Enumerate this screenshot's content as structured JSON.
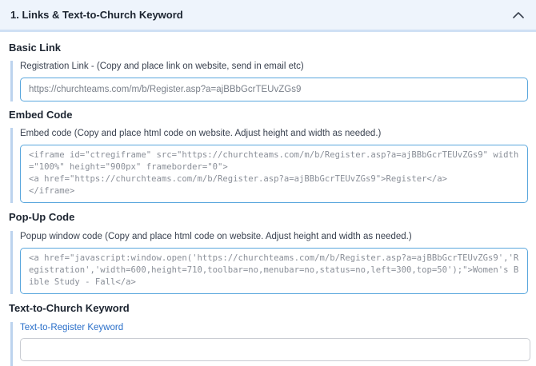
{
  "panel": {
    "title": "1. Links & Text-to-Church Keyword"
  },
  "basic_link": {
    "heading": "Basic Link",
    "label": "Registration Link - (Copy and place link on website, send in email etc)",
    "value": "https://churchteams.com/m/b/Register.asp?a=ajBBbGcrTEUvZGs9"
  },
  "embed_code": {
    "heading": "Embed Code",
    "label": "Embed code (Copy and place html code on website. Adjust height and width as needed.)",
    "value": "<iframe id=\"ctregiframe\" src=\"https://churchteams.com/m/b/Register.asp?a=ajBBbGcrTEUvZGs9\" width=\"100%\" height=\"900px\" frameborder=\"0\">\n<a href=\"https://churchteams.com/m/b/Register.asp?a=ajBBbGcrTEUvZGs9\">Register</a>\n</iframe>"
  },
  "popup_code": {
    "heading": "Pop-Up Code",
    "label": "Popup window code (Copy and place html code on website. Adjust height and width as needed.)",
    "value": "<a href=\"javascript:window.open('https://churchteams.com/m/b/Register.asp?a=ajBBbGcrTEUvZGs9','Registration','width=600,height=710,toolbar=no,menubar=no,status=no,left=300,top=50');\">Women's Bible Study - Fall</a>"
  },
  "keyword": {
    "heading": "Text-to-Church Keyword",
    "label": "Text-to-Register Keyword",
    "value": ""
  }
}
